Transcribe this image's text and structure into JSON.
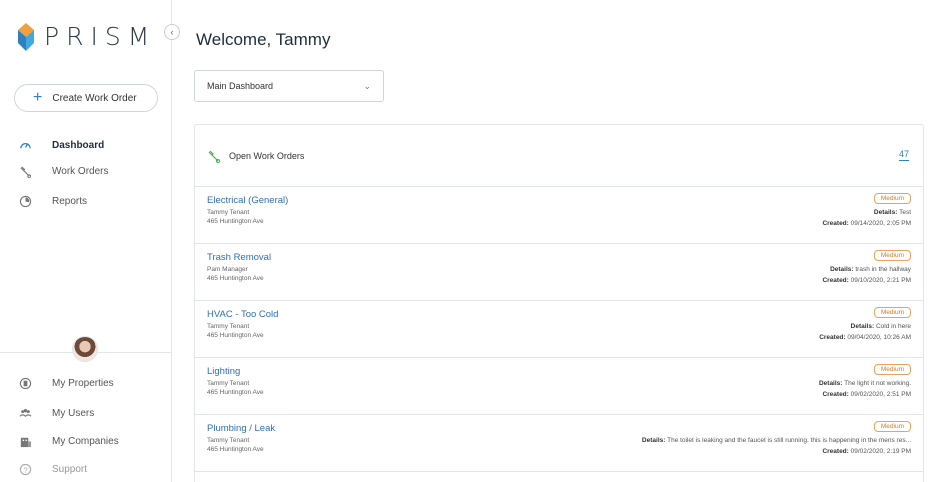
{
  "brand": {
    "name": "PRISM"
  },
  "sidebar": {
    "create_label": "Create Work Order",
    "nav": [
      {
        "label": "Dashboard",
        "icon": "gauge-icon",
        "active": true
      },
      {
        "label": "Work Orders",
        "icon": "wrench-icon",
        "active": false
      },
      {
        "label": "Reports",
        "icon": "report-icon",
        "active": false
      }
    ],
    "bottom_nav": [
      {
        "label": "My Properties",
        "icon": "building-icon"
      },
      {
        "label": "My Users",
        "icon": "users-icon"
      },
      {
        "label": "My Companies",
        "icon": "company-icon"
      },
      {
        "label": "Support",
        "icon": "help-icon"
      }
    ]
  },
  "header": {
    "title": "Welcome, Tammy"
  },
  "dashboard_select": {
    "value": "Main Dashboard"
  },
  "open_work_orders": {
    "title": "Open Work Orders",
    "count": "47",
    "items": [
      {
        "title": "Electrical (General)",
        "person": "Tammy Tenant",
        "address": "465 Huntington Ave",
        "priority": "Medium",
        "details_label": "Details:",
        "details": "Test",
        "created_label": "Created:",
        "created": "09/14/2020, 2:05 PM"
      },
      {
        "title": "Trash Removal",
        "person": "Pam Manager",
        "address": "465 Huntington Ave",
        "priority": "Medium",
        "details_label": "Details:",
        "details": "trash in the hallway",
        "created_label": "Created:",
        "created": "09/10/2020, 2:21 PM"
      },
      {
        "title": "HVAC - Too Cold",
        "person": "Tammy Tenant",
        "address": "465 Huntington Ave",
        "priority": "Medium",
        "details_label": "Details:",
        "details": "Cold in here",
        "created_label": "Created:",
        "created": "09/04/2020, 10:26 AM"
      },
      {
        "title": "Lighting",
        "person": "Tammy Tenant",
        "address": "465 Huntington Ave",
        "priority": "Medium",
        "details_label": "Details:",
        "details": "The light it not working.",
        "created_label": "Created:",
        "created": "09/02/2020, 2:51 PM"
      },
      {
        "title": "Plumbing / Leak",
        "person": "Tammy Tenant",
        "address": "465 Huntington Ave",
        "priority": "Medium",
        "details_label": "Details:",
        "details": "The toilet is leaking and the faucet is still running. this is happening in the mens res...",
        "created_label": "Created:",
        "created": "09/02/2020, 2:19 PM"
      }
    ]
  },
  "colors": {
    "accent": "#2f7fc1",
    "priority_medium": "#e8a25a",
    "logo_top": "#f0a03c",
    "logo_bottom": "#2f7fc1"
  }
}
